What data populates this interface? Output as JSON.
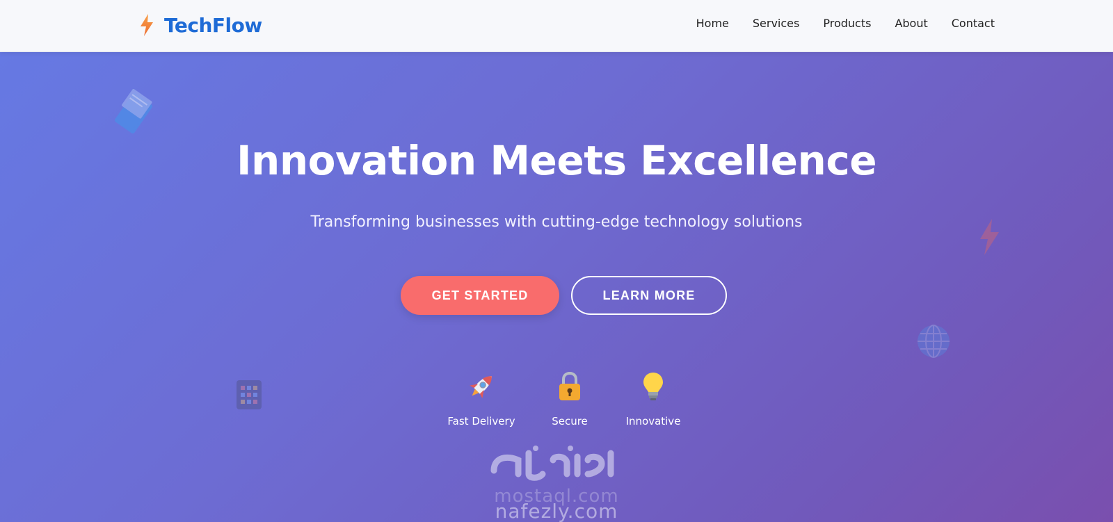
{
  "brand": {
    "name": "TechFlow",
    "icon": "lightning-bolt-icon",
    "color": "#1e6bd6"
  },
  "nav": {
    "items": [
      {
        "label": "Home"
      },
      {
        "label": "Services"
      },
      {
        "label": "Products"
      },
      {
        "label": "About"
      },
      {
        "label": "Contact"
      }
    ]
  },
  "hero": {
    "title": "Innovation Meets Excellence",
    "subtitle": "Transforming businesses with cutting-edge technology solutions",
    "primary_button": "GET STARTED",
    "secondary_button": "LEARN MORE",
    "gradient_start": "#6679e3",
    "gradient_end": "#7a4fae",
    "primary_color": "#f96c6c"
  },
  "features": [
    {
      "icon": "rocket-icon",
      "label": "Fast Delivery"
    },
    {
      "icon": "lock-icon",
      "label": "Secure"
    },
    {
      "icon": "lightbulb-icon",
      "label": "Innovative"
    }
  ],
  "decorations": [
    "tablet-icon",
    "lightning-bolt-icon",
    "globe-icon",
    "app-grid-icon"
  ],
  "watermark": {
    "text_back": "mostaql.com",
    "text": "nafezly.com"
  }
}
